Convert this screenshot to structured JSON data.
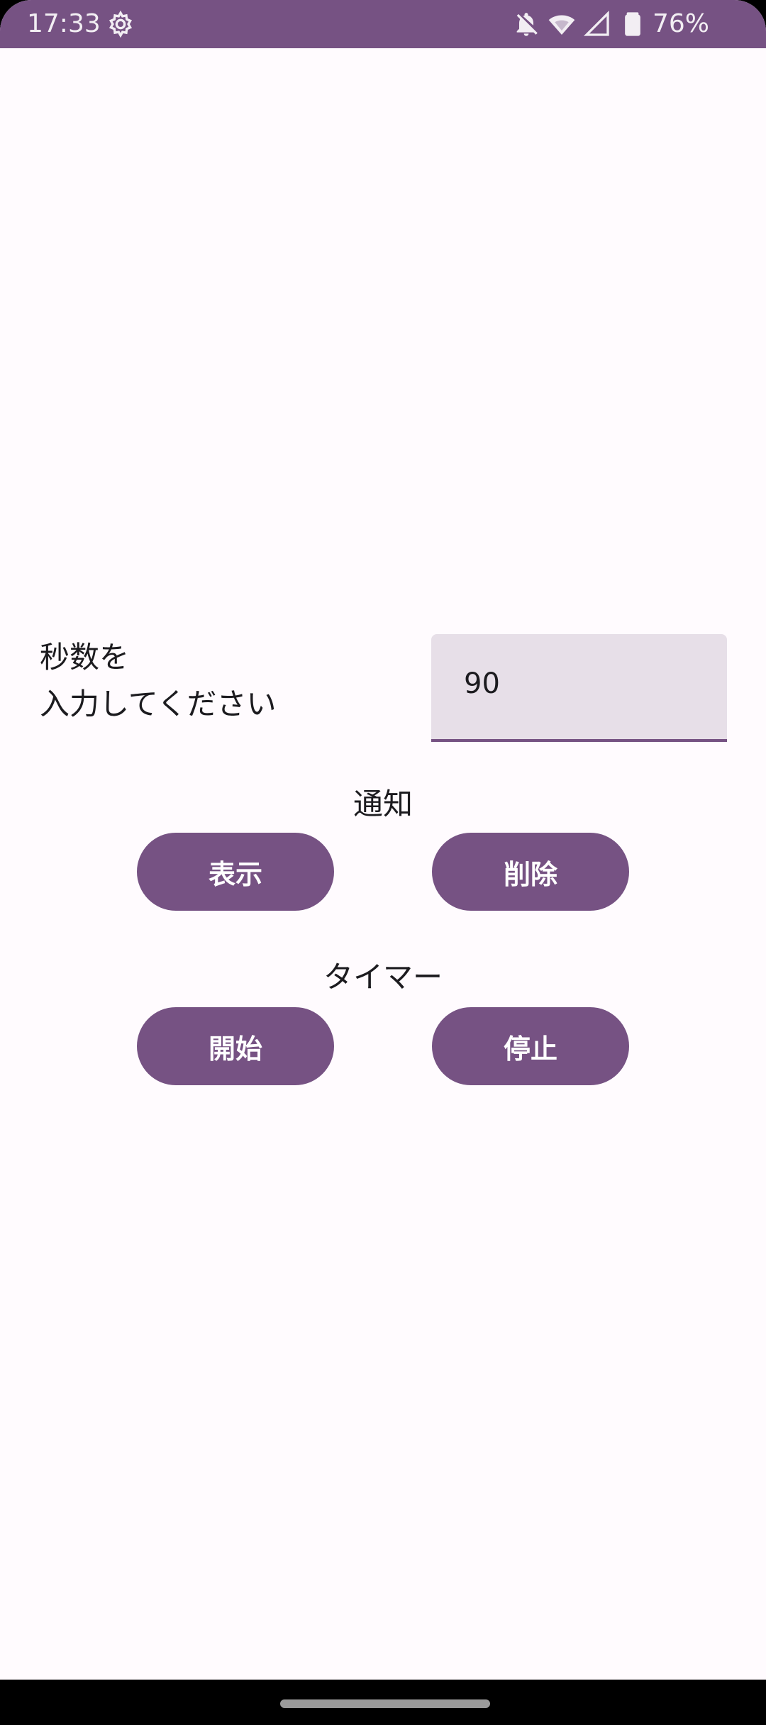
{
  "status_bar": {
    "time": "17:33",
    "battery": "76%",
    "icons": [
      "settings-icon",
      "bell-off-icon",
      "wifi-icon",
      "signal-icon",
      "battery-icon"
    ],
    "color": "#765283"
  },
  "form": {
    "prompt_line1": "秒数を",
    "prompt_line2": "入力してください",
    "seconds_value": "90"
  },
  "notification": {
    "label": "通知",
    "show_button": "表示",
    "delete_button": "削除"
  },
  "timer": {
    "label": "タイマー",
    "start_button": "開始",
    "stop_button": "停止"
  },
  "theme": {
    "accent": "#765283",
    "field_background": "#e7dfe8",
    "background": "#fffbfe"
  }
}
